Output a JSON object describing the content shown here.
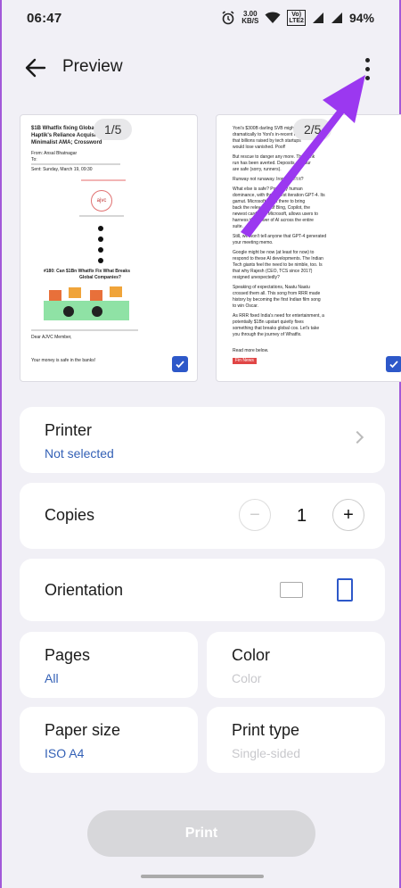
{
  "status": {
    "time": "06:47",
    "speed_value": "3.00",
    "speed_unit": "KB/S",
    "volte_top": "Vo)",
    "volte_bottom": "LTE2",
    "battery": "94%"
  },
  "appbar": {
    "title": "Preview",
    "back_icon": "arrow-left-icon",
    "more_icon": "more-vert-icon"
  },
  "previews": [
    {
      "badge": "1/5",
      "lines": {
        "title1": "$1B Whatfix fixing Global Gr",
        "title2": "Haptik's Reliance Acquisition,",
        "title3": "Minimalist AMA; Crossword",
        "from": "From: Ansal Bhatnagar",
        "to": "To:",
        "sent": "Sent: Sunday, March 19, 09:30",
        "logo": "ajvc",
        "headline1": "#180: Can $1Bn Whatfix Fix What Breaks",
        "headline2": "Global Companies?",
        "dear": "Dear AJVC Member,",
        "money": "Your money is safe in the banks!"
      }
    },
    {
      "badge": "2/5",
      "lines": {
        "l1": "Yoni's $300B darling SVB might be",
        "l2": "dramatically to Yoni's in-recent ratt",
        "l3": "that billions raised by tech startups",
        "l4": "would lose vanished. Poof!",
        "l5": "But rescue to danger any more. The bank",
        "l6": "run has been averted. Deposits and our",
        "l7": "are safe (sorry, runners).",
        "l8": "Runway not runaway. Ironic, isn't it?",
        "l9": "What else is safe? Probably human",
        "l10": "dominance, with their latest iteration GPT-4. Its",
        "l11": "gamut. Microsoft is out there to bring",
        "l12": "back the relevance of Bing, Copilot, the",
        "l13": "newest card from Microsoft, allows users to",
        "l14": "harness the power of AI across the entire",
        "l15": "suite.",
        "l16": "Still, we won't tell anyone that GPT-4 generated",
        "l17": "your meeting memo.",
        "l18": "Google might be now (at least for now) to",
        "l19": "respond to these AI developments. The Indian",
        "l20": "Tech giants feel the need to be nimble, too. Is",
        "l21": "that why Rajesh (CEO, TCS since 2017)",
        "l22": "resigned unexpectedly?",
        "l23": "Speaking of expectations, Naatu Naatu",
        "l24": "crossed them all. This song from RRR made",
        "l25": "history by becoming the first Indian film song",
        "l26": "to win Oscar.",
        "l27": "As RRR fixed India's need for entertainment, a",
        "l28": "potentially $1Bn upstart quietly fixes",
        "l29": "something that breaks global cos. Let's take",
        "l30": "you through the journey of Whatfix.",
        "l31": "Read more below.",
        "tag": "Fin News"
      }
    }
  ],
  "printer": {
    "title": "Printer",
    "value": "Not selected"
  },
  "copies": {
    "title": "Copies",
    "value": "1",
    "minus": "−",
    "plus": "+"
  },
  "orientation": {
    "title": "Orientation",
    "selected": "portrait"
  },
  "pages": {
    "title": "Pages",
    "value": "All"
  },
  "color": {
    "title": "Color",
    "value": "Color"
  },
  "paper_size": {
    "title": "Paper size",
    "value": "ISO A4"
  },
  "print_type": {
    "title": "Print type",
    "value": "Single-sided"
  },
  "print_button": {
    "label": "Print"
  },
  "colors": {
    "accent": "#2d58c9",
    "link": "#3461b6",
    "arrow": "#9b38f0",
    "frame": "#a259d9"
  }
}
